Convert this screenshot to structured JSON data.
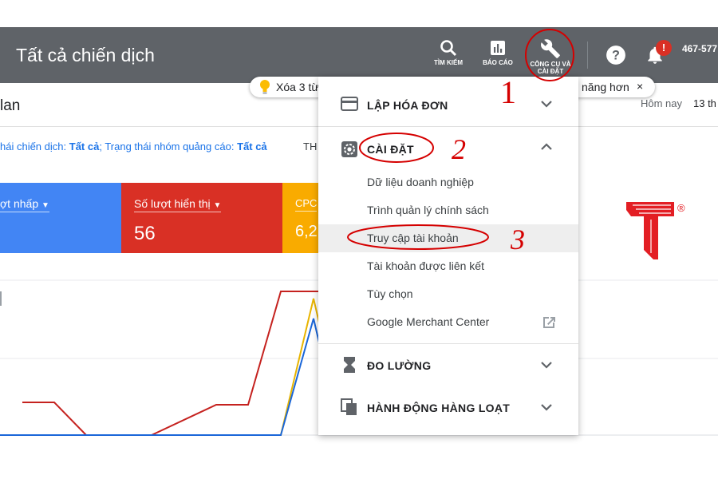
{
  "topbar": {
    "title": "Tất cả chiến dịch",
    "tools": [
      {
        "label": "TÌM KIẾM",
        "icon": "search-icon"
      },
      {
        "label": "BÁO CÁO",
        "icon": "report-icon"
      },
      {
        "label_line1": "CÔNG CỤ VÀ",
        "label_line2": "CÀI ĐẶT",
        "icon": "wrench-icon"
      }
    ],
    "help_icon": "help-icon",
    "notification_icon": "bell-icon",
    "notification_badge": "!",
    "account_id": "467-577"
  },
  "banner": {
    "text_left": "Xóa 3 từ",
    "text_right": "năng hơn",
    "close": "×"
  },
  "subheader": {
    "title": "lan",
    "date_label": "Hôm nay",
    "date_value": "13 th"
  },
  "filter": {
    "campaign_status_label": "hái chiến dịch:",
    "campaign_status_value": "Tất cả",
    "adgroup_status_label": "; Trạng thái nhóm quảng cáo:",
    "adgroup_status_value": "Tất cả",
    "extra": "TH"
  },
  "metrics": [
    {
      "label": "ợt nhấp",
      "value": "",
      "color": "#4285f4"
    },
    {
      "label": "Số lượt hiển thị",
      "value": "56",
      "color": "#d93025"
    },
    {
      "label": "CPC",
      "value": "6,2",
      "color": "#f9ab00"
    }
  ],
  "menu": {
    "billing": {
      "title": "LẬP HÓA ĐƠN",
      "icon": "credit-card-icon"
    },
    "settings": {
      "title": "CÀI ĐẶT",
      "icon": "gear-icon",
      "items": [
        {
          "label": "Dữ liệu doanh nghiệp"
        },
        {
          "label": "Trình quản lý chính sách"
        },
        {
          "label": "Truy cập tài khoản"
        },
        {
          "label": "Tài khoản được liên kết"
        },
        {
          "label": "Tùy chọn"
        },
        {
          "label": "Google Merchant Center",
          "icon": "external-link-icon"
        }
      ]
    },
    "measurement": {
      "title": "ĐO LƯỜNG",
      "icon": "hourglass-icon"
    },
    "bulk": {
      "title": "HÀNH ĐỘNG HÀNG LOẠT",
      "icon": "copy-icon"
    }
  },
  "annotations": {
    "step1": "1",
    "step2": "2",
    "step3": "3",
    "color": "#d50000"
  },
  "logo": {
    "mark": "T",
    "registered": "®",
    "color": "#e31e24"
  }
}
